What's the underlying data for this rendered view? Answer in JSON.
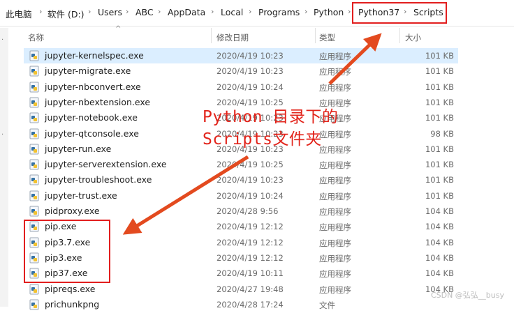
{
  "breadcrumb": [
    "此电脑",
    "软件 (D:)",
    "Users",
    "ABC",
    "AppData",
    "Local",
    "Programs",
    "Python",
    "Python37",
    "Scripts"
  ],
  "columns": {
    "name": "名称",
    "modified": "修改日期",
    "type": "类型",
    "size": "大小"
  },
  "files": [
    {
      "name": "jupyter-kernelspec.exe",
      "date": "2020/4/19 10:23",
      "type": "应用程序",
      "size": "101 KB"
    },
    {
      "name": "jupyter-migrate.exe",
      "date": "2020/4/19 10:23",
      "type": "应用程序",
      "size": "101 KB"
    },
    {
      "name": "jupyter-nbconvert.exe",
      "date": "2020/4/19 10:24",
      "type": "应用程序",
      "size": "101 KB"
    },
    {
      "name": "jupyter-nbextension.exe",
      "date": "2020/4/19 10:25",
      "type": "应用程序",
      "size": "101 KB"
    },
    {
      "name": "jupyter-notebook.exe",
      "date": "2020/4/19 10:23",
      "type": "应用程序",
      "size": "101 KB"
    },
    {
      "name": "jupyter-qtconsole.exe",
      "date": "2020/4/19 10:23",
      "type": "应用程序",
      "size": "98 KB"
    },
    {
      "name": "jupyter-run.exe",
      "date": "2020/4/19 10:23",
      "type": "应用程序",
      "size": "101 KB"
    },
    {
      "name": "jupyter-serverextension.exe",
      "date": "2020/4/19 10:25",
      "type": "应用程序",
      "size": "101 KB"
    },
    {
      "name": "jupyter-troubleshoot.exe",
      "date": "2020/4/19 10:23",
      "type": "应用程序",
      "size": "101 KB"
    },
    {
      "name": "jupyter-trust.exe",
      "date": "2020/4/19 10:24",
      "type": "应用程序",
      "size": "101 KB"
    },
    {
      "name": "pidproxy.exe",
      "date": "2020/4/28 9:56",
      "type": "应用程序",
      "size": "104 KB"
    },
    {
      "name": "pip.exe",
      "date": "2020/4/19 12:12",
      "type": "应用程序",
      "size": "104 KB"
    },
    {
      "name": "pip3.7.exe",
      "date": "2020/4/19 12:12",
      "type": "应用程序",
      "size": "104 KB"
    },
    {
      "name": "pip3.exe",
      "date": "2020/4/19 12:12",
      "type": "应用程序",
      "size": "104 KB"
    },
    {
      "name": "pip37.exe",
      "date": "2020/4/19 10:11",
      "type": "应用程序",
      "size": "104 KB"
    },
    {
      "name": "pipreqs.exe",
      "date": "2020/4/27 19:48",
      "type": "应用程序",
      "size": "104 KB"
    },
    {
      "name": "prichunkpng",
      "date": "2020/4/28 17:24",
      "type": "文件",
      "size": ""
    }
  ],
  "annotation": "Python 目录下的\nScripts文件夹",
  "watermark": "CSDN @弘弘__busy",
  "colors": {
    "highlight": "#e21e1e",
    "selected_row": "#dbeeff",
    "annotation": "#e2231a"
  },
  "icons": {
    "file": "python-exe-icon",
    "separator": "chevron-right-icon",
    "sort": "sort-up-icon"
  }
}
